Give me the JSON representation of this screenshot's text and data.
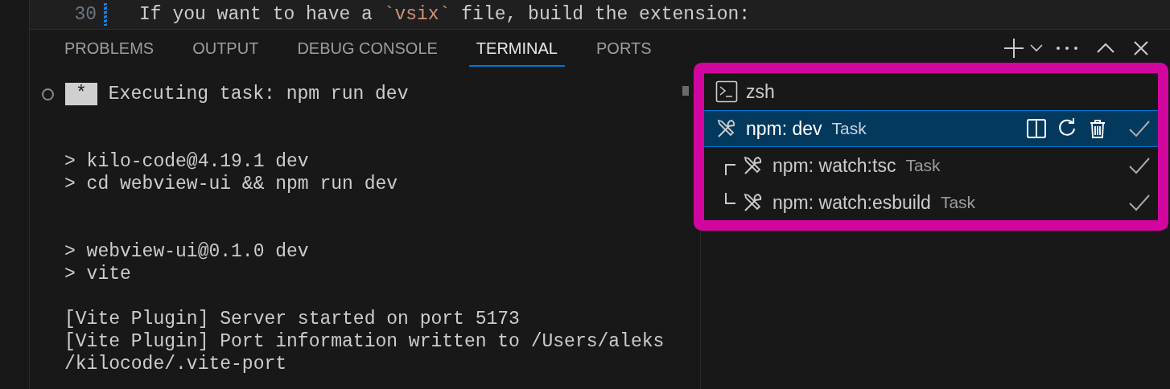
{
  "editor": {
    "line_number": "30",
    "parts": [
      {
        "kind": "plain",
        "text": "If you want to have a "
      },
      {
        "kind": "code",
        "text": "`vsix`"
      },
      {
        "kind": "plain",
        "text": " file, build the extension:"
      }
    ]
  },
  "tabs": [
    {
      "label": "PROBLEMS",
      "selected": false
    },
    {
      "label": "OUTPUT",
      "selected": false
    },
    {
      "label": "DEBUG CONSOLE",
      "selected": false
    },
    {
      "label": "TERMINAL",
      "selected": true
    },
    {
      "label": "PORTS",
      "selected": false
    }
  ],
  "terminal": {
    "blocks": [
      {
        "lines": [
          {
            "badge": "*",
            "text": "Executing task: npm run dev"
          }
        ]
      },
      {
        "lines": [
          {
            "text": "> kilo-code@4.19.1 dev"
          },
          {
            "text": "> cd webview-ui && npm run dev"
          }
        ]
      },
      {
        "lines": [
          {
            "text": "> webview-ui@0.1.0 dev"
          },
          {
            "text": "> vite"
          }
        ]
      },
      {
        "lines": [
          {
            "text": "[Vite Plugin] Server started on port 5173"
          },
          {
            "text": "[Vite Plugin] Port information written to /Users/aleks"
          },
          {
            "text": "/kilocode/.vite-port"
          }
        ]
      }
    ]
  },
  "terminal_list": [
    {
      "kind": "shell",
      "name": "zsh",
      "selected": false
    },
    {
      "kind": "task",
      "name": "npm: dev",
      "tag": "Task",
      "selected": true,
      "done": true,
      "children": [
        {
          "kind": "task",
          "name": "npm: watch:tsc",
          "tag": "Task",
          "selected": false,
          "done": true
        },
        {
          "kind": "task",
          "name": "npm: watch:esbuild",
          "tag": "Task",
          "selected": false,
          "done": true
        }
      ]
    }
  ]
}
